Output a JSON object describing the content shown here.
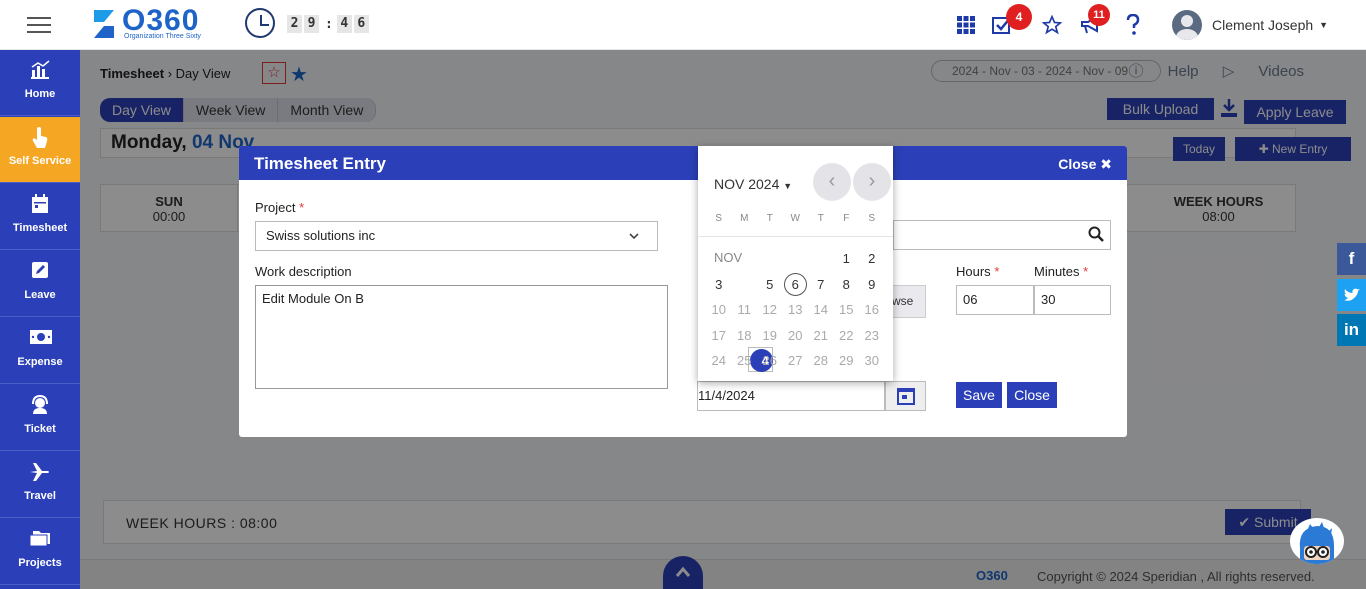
{
  "topbar": {
    "brand": "O360",
    "tagline": "Organization Three Sixty",
    "timer": {
      "h1": "2",
      "h2": "9",
      "m1": "4",
      "m2": "6"
    },
    "tasks_badge": "4",
    "announce_badge": "11",
    "user_name": "Clement Joseph"
  },
  "sidebar": {
    "items": [
      {
        "label": "Home",
        "icon": "home-chart-icon"
      },
      {
        "label": "Self Service",
        "icon": "hand-pointer-icon"
      },
      {
        "label": "Timesheet",
        "icon": "calendar-icon"
      },
      {
        "label": "Leave",
        "icon": "edit-icon"
      },
      {
        "label": "Expense",
        "icon": "money-icon"
      },
      {
        "label": "Ticket",
        "icon": "headset-icon"
      },
      {
        "label": "Travel",
        "icon": "plane-icon"
      },
      {
        "label": "Projects",
        "icon": "folder-icon"
      }
    ]
  },
  "page": {
    "breadcrumb_root": "Timesheet",
    "breadcrumb_sep": "›",
    "breadcrumb_current": "Day View",
    "help": "Help",
    "videos": "Videos",
    "tabs": [
      "Day View",
      "Week View",
      "Month View"
    ],
    "bulk_upload": "Bulk Upload",
    "apply_leave": "Apply Leave",
    "day_title_prefix": "Monday,",
    "day_title_date": "04 Nov",
    "date_range": "2024 - Nov - 03 - 2024 - Nov - 09",
    "today": "Today",
    "new_entry": "New Entry",
    "week_cells": [
      {
        "day": "SUN",
        "time": "00:00"
      },
      {
        "day": "WEEK HOURS",
        "time": "08:00"
      }
    ],
    "week_total": "WEEK HOURS  : 08:00",
    "submit": "Submit",
    "footer_logo": "O360",
    "copyright": "Copyright © 2024 Speridian , All rights reserved."
  },
  "modal": {
    "title": "Timesheet Entry",
    "close_x": "Close ✖",
    "project_label": "Project",
    "project_value": "Swiss solutions inc",
    "work_label": "Work description",
    "work_value": "Edit Module On B",
    "browse": "wse",
    "hours_label": "Hours",
    "hours_value": "06",
    "minutes_label": "Minutes",
    "minutes_value": "30",
    "date_value": "11/4/2024",
    "save": "Save",
    "close": "Close"
  },
  "datepicker": {
    "month_year": "NOV 2024",
    "dows": [
      "S",
      "M",
      "T",
      "W",
      "T",
      "F",
      "S"
    ],
    "month_label": "NOV",
    "selected": "4",
    "today": "6",
    "rows": [
      [
        "",
        "",
        "",
        "",
        "",
        "1",
        "2"
      ],
      [
        "3",
        "4",
        "5",
        "6",
        "7",
        "8",
        "9"
      ],
      [
        "10",
        "11",
        "12",
        "13",
        "14",
        "15",
        "16"
      ],
      [
        "17",
        "18",
        "19",
        "20",
        "21",
        "22",
        "23"
      ],
      [
        "24",
        "25",
        "26",
        "27",
        "28",
        "29",
        "30"
      ]
    ]
  },
  "colors": {
    "primary": "#2b40b8",
    "accent": "#f5a623",
    "badge": "#e02020"
  }
}
